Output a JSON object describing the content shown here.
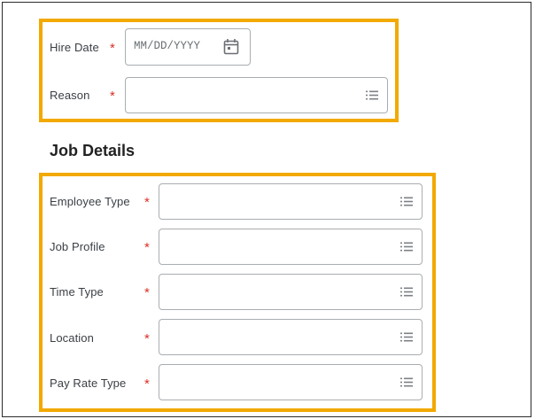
{
  "hire_section": {
    "hire_date": {
      "label": "Hire Date",
      "required_mark": "*",
      "placeholder": "MM/DD/YYYY",
      "icon": "calendar-icon"
    },
    "reason": {
      "label": "Reason",
      "required_mark": "*",
      "value": "",
      "icon": "list-icon"
    }
  },
  "job_details": {
    "title": "Job Details",
    "fields": [
      {
        "label": "Employee Type",
        "required_mark": "*",
        "value": "",
        "icon": "list-icon"
      },
      {
        "label": "Job Profile",
        "required_mark": "*",
        "value": "",
        "icon": "list-icon"
      },
      {
        "label": "Time Type",
        "required_mark": "*",
        "value": "",
        "icon": "list-icon"
      },
      {
        "label": "Location",
        "required_mark": "*",
        "value": "",
        "icon": "list-icon"
      },
      {
        "label": "Pay Rate Type",
        "required_mark": "*",
        "value": "",
        "icon": "list-icon"
      }
    ]
  },
  "colors": {
    "highlight": "#f2a900",
    "required": "#d93025",
    "field_border": "#a9adb1"
  }
}
